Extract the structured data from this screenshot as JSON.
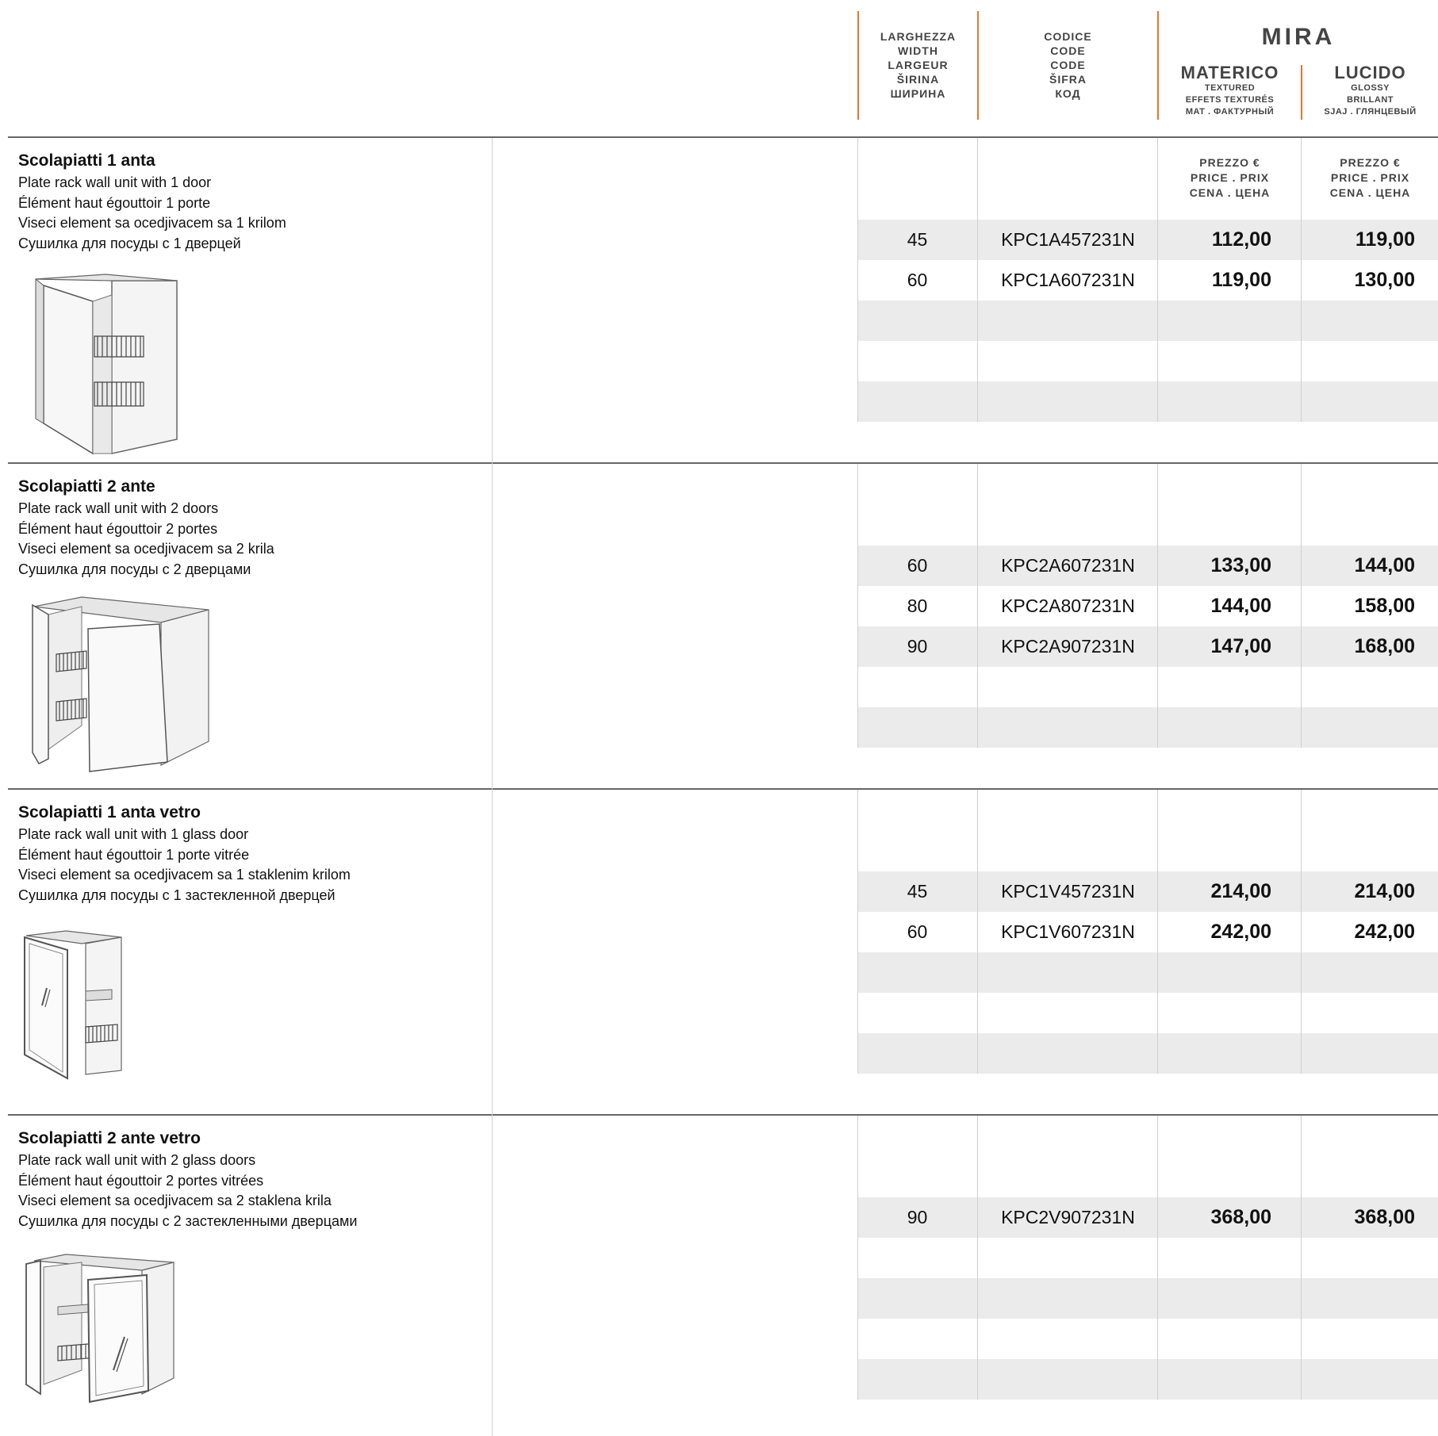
{
  "header": {
    "width_labels": [
      "LARGHEZZA",
      "WIDTH",
      "LARGEUR",
      "ŠIRINA",
      "ШИРИНА"
    ],
    "code_labels": [
      "CODICE",
      "CODE",
      "CODE",
      "ŠIFRA",
      "КОД"
    ],
    "collection": "MIRA",
    "finish_1": {
      "title": "MATERICO",
      "sub": [
        "TEXTURED",
        "EFFETS TEXTURÉS",
        "MAT . ФАКТУРНЫЙ"
      ]
    },
    "finish_2": {
      "title": "LUCIDO",
      "sub": [
        "GLOSSY",
        "BRILLANT",
        "SJAJ . ГЛЯНЦЕВЫЙ"
      ]
    },
    "price_label": [
      "PREZZO €",
      "PRICE . PRIX",
      "CENA . ЦЕНА"
    ]
  },
  "colors": {
    "accent": "#e8752f",
    "band": "#ebebeb",
    "separator": "#666666"
  },
  "products": [
    {
      "title": "Scolapiatti 1 anta",
      "desc": [
        "Plate rack wall unit with 1 door",
        "Élément haut égouttoir 1 porte",
        "Viseci element sa ocedjivacem sa 1 krilom",
        "Сушилка для посуды с 1 дверцей"
      ],
      "image": "plate-rack-1-door-illustration",
      "rows": [
        {
          "width": "45",
          "code": "KPC1A457231N",
          "materico": "112,00",
          "lucido": "119,00"
        },
        {
          "width": "60",
          "code": "KPC1A607231N",
          "materico": "119,00",
          "lucido": "130,00"
        }
      ]
    },
    {
      "title": "Scolapiatti 2 ante",
      "desc": [
        "Plate rack wall unit with 2 doors",
        "Élément haut égouttoir 2 portes",
        "Viseci element sa ocedjivacem sa 2 krila",
        "Сушилка для посуды с 2 дверцами"
      ],
      "image": "plate-rack-2-doors-illustration",
      "rows": [
        {
          "width": "60",
          "code": "KPC2A607231N",
          "materico": "133,00",
          "lucido": "144,00"
        },
        {
          "width": "80",
          "code": "KPC2A807231N",
          "materico": "144,00",
          "lucido": "158,00"
        },
        {
          "width": "90",
          "code": "KPC2A907231N",
          "materico": "147,00",
          "lucido": "168,00"
        }
      ]
    },
    {
      "title": "Scolapiatti 1 anta vetro",
      "desc": [
        "Plate rack wall unit with 1 glass door",
        "Élément haut égouttoir 1 porte vitrée",
        "Viseci element sa ocedjivacem sa 1 staklenim krilom",
        "Сушилка для посуды с 1 застекленной дверцей"
      ],
      "image": "plate-rack-1-glass-door-illustration",
      "rows": [
        {
          "width": "45",
          "code": "KPC1V457231N",
          "materico": "214,00",
          "lucido": "214,00"
        },
        {
          "width": "60",
          "code": "KPC1V607231N",
          "materico": "242,00",
          "lucido": "242,00"
        }
      ]
    },
    {
      "title": "Scolapiatti 2 ante vetro",
      "desc": [
        "Plate rack wall unit with 2 glass doors",
        "Élément haut égouttoir 2 portes vitrées",
        "Viseci element sa ocedjivacem sa 2 staklena krila",
        "Сушилка для посуды с 2 застекленными дверцами"
      ],
      "image": "plate-rack-2-glass-doors-illustration",
      "rows": [
        {
          "width": "90",
          "code": "KPC2V907231N",
          "materico": "368,00",
          "lucido": "368,00"
        }
      ]
    }
  ]
}
